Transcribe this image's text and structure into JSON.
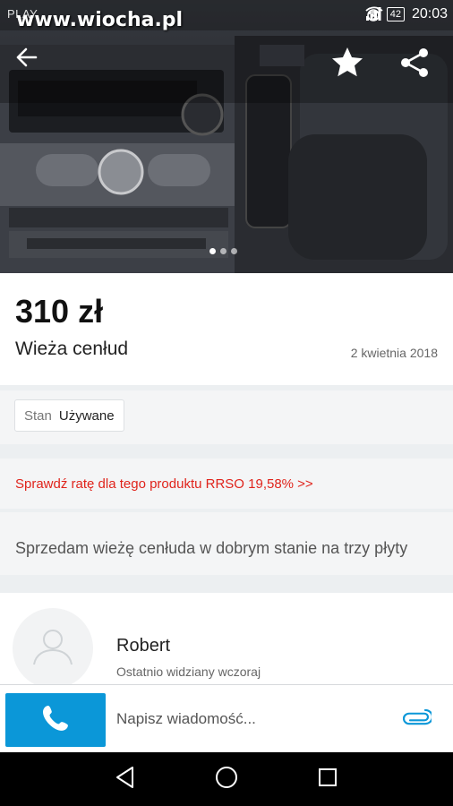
{
  "status_bar": {
    "carrier": "PLAY",
    "watermark": "www.wiocha.pl",
    "battery": "42",
    "time": "20:03"
  },
  "gallery": {
    "image_description": "stereo-system-photo",
    "total_images": 3,
    "active_index": 1
  },
  "listing": {
    "price": "310 zł",
    "title": "Wieża cenłud",
    "date": "2 kwietnia 2018"
  },
  "params": [
    {
      "key": "Stan",
      "value": "Używane"
    }
  ],
  "rate_link": "Sprawdź ratę dla tego produktu RRSO 19,58% >>",
  "description": "Sprzedam wieżę cenłuda w dobrym stanie na trzy płyty",
  "seller": {
    "name": "Robert",
    "last_seen": "Ostatnio widziany wczoraj"
  },
  "message_bar": {
    "placeholder": "Napisz wiadomość..."
  },
  "colors": {
    "accent": "#0b97d8",
    "rate_link": "#e0241c"
  },
  "icons": {
    "back": "arrow-left",
    "favorite": "star",
    "share": "share",
    "call": "phone",
    "attach": "paperclip"
  }
}
